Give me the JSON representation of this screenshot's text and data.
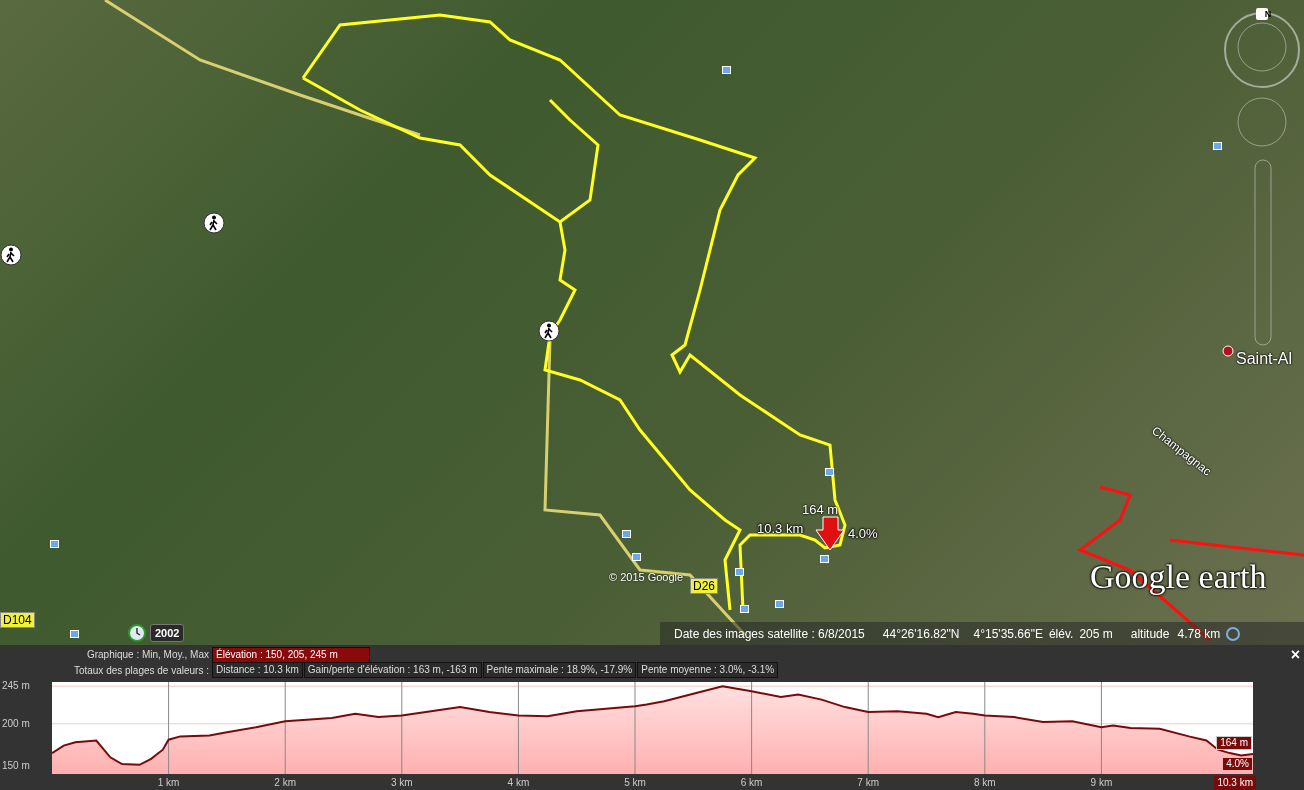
{
  "map": {
    "track_labels": {
      "elevation": "164 m",
      "distance": "10.3 km",
      "slope": "4.0%"
    },
    "place_labels": [
      {
        "text": "Saint-Al"
      },
      {
        "text": "Champagnac"
      }
    ],
    "road_labels": [
      {
        "parts": [
          "D104"
        ]
      },
      {
        "parts": [
          "D2",
          "6"
        ]
      }
    ],
    "copyright": "© 2015 Google",
    "logo": "Google earth",
    "historical_year": "2002",
    "compass_letter": "N"
  },
  "status_bar": {
    "imagery_date": "Date des images satellite : 6/8/2015",
    "latitude": "44°26'16.82\"N",
    "longitude": "4°15'35.66\"E",
    "elevation_label": "élév.",
    "elevation": "205 m",
    "altitude_label": "altitude",
    "altitude": "4.78 km"
  },
  "profile": {
    "close": "×",
    "graph_label": "Graphique : Min, Moy., Max",
    "graph_value": "Élévation : 150, 205, 245 m",
    "totals_label": "Totaux des plages de valeurs :",
    "totals": [
      "Distance : 10.3 km",
      "Gain/perte d'élévation : 163 m, -163 m",
      "Pente maximale : 18.9%, -17.9%",
      "Pente moyenne : 3.0%, -3.1%"
    ],
    "chart_data": {
      "type": "area",
      "x": [
        0,
        0.1,
        0.2,
        0.38,
        0.5,
        0.6,
        0.75,
        0.85,
        0.95,
        1.0,
        1.1,
        1.35,
        1.5,
        1.75,
        2.0,
        2.4,
        2.6,
        2.8,
        3.0,
        3.25,
        3.5,
        3.75,
        4.0,
        4.25,
        4.5,
        4.75,
        5.0,
        5.1,
        5.25,
        5.5,
        5.75,
        6.0,
        6.25,
        6.4,
        6.6,
        6.8,
        7.0,
        7.25,
        7.5,
        7.6,
        7.75,
        7.9,
        8.0,
        8.25,
        8.5,
        8.75,
        9.0,
        9.1,
        9.25,
        9.5,
        9.75,
        9.9,
        10.0,
        10.1,
        10.2,
        10.3
      ],
      "grid": true,
      "series": [
        {
          "color": "#7a0a0a",
          "values": [
            165,
            174,
            178,
            180,
            160,
            152,
            151,
            158,
            169,
            181,
            185,
            186,
            190,
            196,
            203,
            207,
            212,
            208,
            210,
            215,
            220,
            214,
            210,
            209,
            215,
            218,
            221,
            223,
            227,
            236,
            245,
            239,
            232,
            235,
            229,
            220,
            214,
            215,
            212,
            208,
            214,
            212,
            210,
            208,
            202,
            203,
            196,
            198,
            195,
            194,
            185,
            180,
            169,
            165,
            162,
            164
          ]
        }
      ],
      "xlim": [
        0,
        10.3
      ],
      "ylim": [
        140,
        250
      ],
      "xticks": [
        {
          "value": 1,
          "label": "1 km"
        },
        {
          "value": 2,
          "label": "2 km"
        },
        {
          "value": 3,
          "label": "3 km"
        },
        {
          "value": 4,
          "label": "4 km"
        },
        {
          "value": 5,
          "label": "5 km"
        },
        {
          "value": 6,
          "label": "6 km"
        },
        {
          "value": 7,
          "label": "7 km"
        },
        {
          "value": 8,
          "label": "8 km"
        },
        {
          "value": 9,
          "label": "9 km"
        }
      ],
      "yticks": [
        {
          "value": 150,
          "label": "150 m"
        },
        {
          "value": 200,
          "label": "200 m"
        },
        {
          "value": 245,
          "label": "245 m"
        }
      ],
      "annotations": [
        "164 m",
        "4.0%",
        "10.3 km"
      ]
    }
  }
}
